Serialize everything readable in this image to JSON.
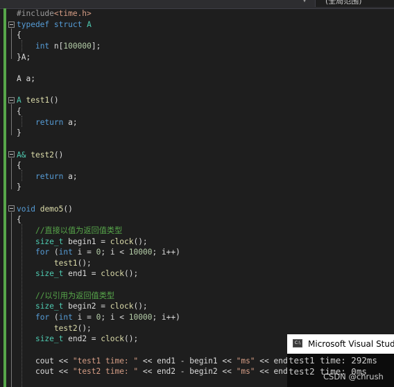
{
  "header": {
    "scope_label": "(全局范围)"
  },
  "code": {
    "include": [
      "#include",
      "<time.h>"
    ],
    "l_typedef": [
      "typedef",
      "struct",
      "A"
    ],
    "l_open": "{",
    "l_int": [
      "int",
      "n[",
      "100000",
      "];"
    ],
    "l_close_A": "}A;",
    "l_decl": "A a;",
    "l_test1_sig": [
      "A",
      "test1",
      "()"
    ],
    "l_return_a": [
      "return",
      "a;"
    ],
    "l_close": "}",
    "l_test2_sig": [
      "A&",
      "test2",
      "()"
    ],
    "l_demo5_sig": [
      "void",
      "demo5",
      "()"
    ],
    "l_comment1": "//直接以值为返回值类型",
    "l_begin1": [
      "size_t",
      "begin1 =",
      "clock",
      "();"
    ],
    "l_for": [
      "for",
      "(",
      "int",
      "i = ",
      "0",
      "; i < ",
      "10000",
      "; i++)"
    ],
    "l_test1_call": [
      "test1",
      "();"
    ],
    "l_end1": [
      "size_t",
      "end1 =",
      "clock",
      "();"
    ],
    "l_comment2": "//以引用为返回值类型",
    "l_begin2": [
      "size_t",
      "begin2 =",
      "clock",
      "();"
    ],
    "l_test2_call": [
      "test2",
      "();"
    ],
    "l_end2": [
      "size_t",
      "end2 =",
      "clock",
      "();"
    ],
    "l_cout1": [
      "cout << ",
      "\"test1 time: \"",
      " << end1 - begin1 << ",
      "\"ms\"",
      " << endl;"
    ],
    "l_cout2": [
      "cout << ",
      "\"test2 time: \"",
      " << end2 - begin2 << ",
      "\"ms\"",
      " << endl;"
    ]
  },
  "console": {
    "title": "Microsoft Visual Stud",
    "icon_text": "C:\\",
    "out1": "test1 time: 292ms",
    "out2": "test2 time: 0ms"
  },
  "watermark": "CSDN @chrush",
  "colors": {
    "background": "#1e1e1e",
    "keyword": "#569cd6",
    "type": "#4ec9b0",
    "function": "#dcdcaa",
    "number": "#b5cea8",
    "string": "#d69d85",
    "comment": "#57a64a"
  }
}
